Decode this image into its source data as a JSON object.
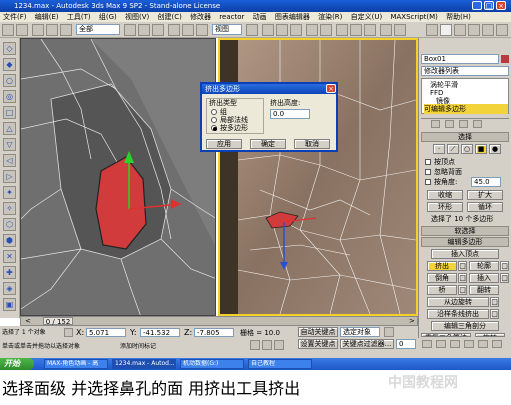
{
  "window": {
    "title": "1234.max - Autodesk 3ds Max 9 SP2 - Stand-alone License"
  },
  "menubar": {
    "items": [
      "文件(F)",
      "编辑(E)",
      "工具(T)",
      "组(G)",
      "视图(V)",
      "创建(C)",
      "修改器",
      "reactor",
      "动画",
      "图表编辑器",
      "渲染(R)",
      "自定义(U)",
      "MAXScript(M)",
      "帮助(H)"
    ]
  },
  "toolbar": {
    "filter_value": "全部",
    "view_value": "视图"
  },
  "dialog": {
    "title": "挤出多边形",
    "group_label": "挤出类型",
    "options": [
      "组",
      "局部法线",
      "按多边形"
    ],
    "selected_index": 2,
    "height_label": "挤出高度:",
    "height_value": "0.0",
    "buttons": {
      "apply": "应用",
      "ok": "确定",
      "cancel": "取消"
    }
  },
  "command_panel": {
    "object_name": "Box01",
    "modifier_list": "修改器列表",
    "stack": [
      "涡轮平滑",
      "FFD",
      "镜像",
      "可编辑多边形"
    ],
    "selection_rollout": "选择",
    "checkboxes": [
      "按顶点",
      "忽略背面",
      "按角度:"
    ],
    "angle_value": "45.0",
    "shrink": "收缩",
    "grow": "扩大",
    "ring": "环形",
    "loop": "循环",
    "selection_status": "选择了 10 个多边形",
    "soft_selection": "软选择",
    "edit_poly_rollout": "编辑多边形",
    "insert_vertex": "插入顶点",
    "extrude": "挤出",
    "outline": "轮廓",
    "bevel": "倒角",
    "inset": "插入",
    "bridge": "桥",
    "flip": "翻转",
    "hinge_from_edge": "从边旋转",
    "extrude_along_spline": "沿样条线挤出",
    "edit_triangulation": "编辑三角剖分",
    "retriangulate": "重复三角算法",
    "turn": "旋转"
  },
  "timeline": {
    "frame_label": "0 / 152"
  },
  "status": {
    "selection": "选择了 1 个对象",
    "x_label": "X:",
    "x": "5.071",
    "y_label": "Y:",
    "y": "-41.532",
    "z_label": "Z:",
    "z": "-7.805",
    "grid": "栅格 = 10.0",
    "autokey": "自动关键点",
    "selected_obj": "选定对象",
    "set_key": "设置关键点",
    "key_filters": "关键点过滤器...",
    "frame_value": "0",
    "prompt": "单击或单击并拖动以选择对象",
    "add_time_tag": "添加时间标记"
  },
  "taskbar": {
    "start": "开始",
    "tasks": [
      "MAX-角色动画 - 高",
      "1234.max - Autod...",
      "机动数据(G:)",
      "自己教程"
    ]
  },
  "caption": "选择面级  并选择鼻孔的面 用挤出工具挤出",
  "watermark": "中国教程网"
}
